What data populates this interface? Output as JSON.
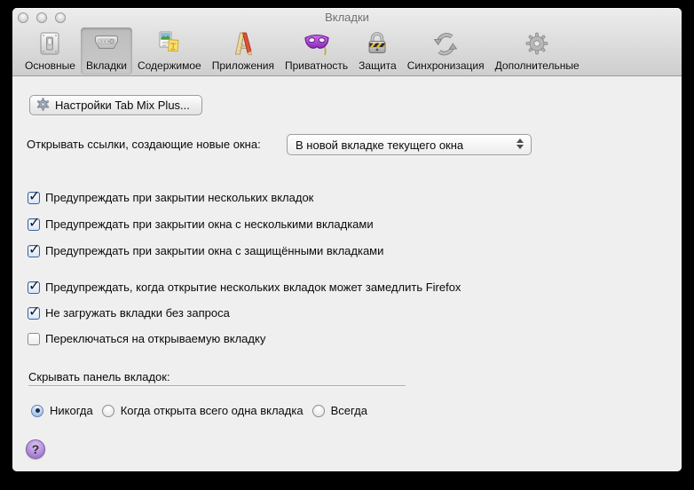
{
  "window": {
    "title": "Вкладки",
    "traffic_lights": {
      "close": "close",
      "minimize": "minimize",
      "zoom": "zoom"
    }
  },
  "toolbar": {
    "items": [
      {
        "label": "Основные",
        "icon": "general-switch-icon",
        "selected": false
      },
      {
        "label": "Вкладки",
        "icon": "tabs-icon",
        "selected": true
      },
      {
        "label": "Содержимое",
        "icon": "content-icon",
        "selected": false
      },
      {
        "label": "Приложения",
        "icon": "applications-icon",
        "selected": false
      },
      {
        "label": "Приватность",
        "icon": "privacy-mask-icon",
        "selected": false
      },
      {
        "label": "Защита",
        "icon": "security-lock-icon",
        "selected": false
      },
      {
        "label": "Синхронизация",
        "icon": "sync-icon",
        "selected": false
      },
      {
        "label": "Дополнительные",
        "icon": "advanced-gear-icon",
        "selected": false
      }
    ]
  },
  "content": {
    "tab_mix_plus_button": "Настройки Tab Mix Plus...",
    "open_links_label": "Открывать ссылки, создающие новые окна:",
    "open_links_value": "В новой вкладке текущего окна",
    "checkboxes": [
      {
        "label": "Предупреждать при закрытии нескольких вкладок",
        "checked": true
      },
      {
        "label": "Предупреждать при закрытии окна с несколькими вкладками",
        "checked": true
      },
      {
        "label": "Предупреждать при закрытии окна с защищёнными вкладками",
        "checked": true
      },
      {
        "label": "Предупреждать, когда открытие нескольких вкладок может замедлить Firefox",
        "checked": true
      },
      {
        "label": "Не загружать вкладки без запроса",
        "checked": true
      },
      {
        "label": "Переключаться на открываемую вкладку",
        "checked": false
      }
    ],
    "hide_tab_bar": {
      "label": "Скрывать панель вкладок:",
      "options": [
        {
          "label": "Никогда",
          "selected": true
        },
        {
          "label": "Когда открыта всего одна вкладка",
          "selected": false
        },
        {
          "label": "Всегда",
          "selected": false
        }
      ]
    },
    "help_button": "?"
  },
  "colors": {
    "window_chrome_top": "#ededed",
    "window_chrome_bottom": "#cecece",
    "content_background": "#efefef",
    "checkbox_accent": "#39629c",
    "help_button_purple": "#a87fd4",
    "selected_toolbar_item": "#c3c3c3"
  }
}
